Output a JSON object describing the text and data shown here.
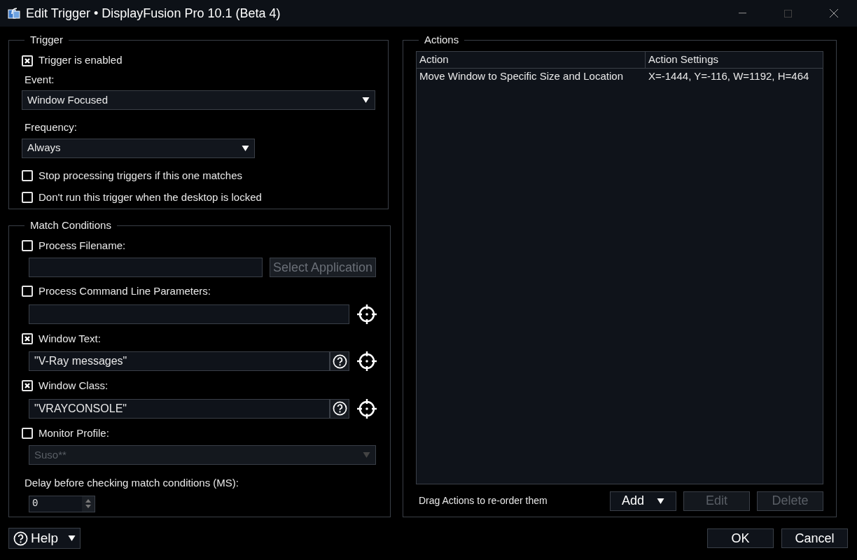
{
  "window": {
    "title": "Edit Trigger • DisplayFusion Pro 10.1 (Beta 4)"
  },
  "trigger": {
    "title": "Trigger",
    "enabled": {
      "label": "Trigger is enabled",
      "checked": true
    },
    "event": {
      "label": "Event:",
      "value": "Window Focused"
    },
    "frequency": {
      "label": "Frequency:",
      "value": "Always"
    },
    "options": [
      {
        "label": "Stop processing triggers if this one matches",
        "checked": false
      },
      {
        "label": "Don't run this trigger when the desktop is locked",
        "checked": false
      }
    ]
  },
  "match_conditions": {
    "title": "Match Conditions",
    "conditions": [
      {
        "kind": "app",
        "label": "Process Filename:",
        "checked": false,
        "button": {
          "label": "Select Application",
          "disabled": true
        }
      },
      {
        "kind": "pick",
        "label": "Process Command Line Parameters:",
        "checked": false
      },
      {
        "kind": "text",
        "label": "Window Text:",
        "checked": true,
        "value": "\"V-Ray messages\""
      },
      {
        "kind": "text",
        "label": "Window Class:",
        "checked": true,
        "value": "\"VRAYCONSOLE\""
      },
      {
        "kind": "dropdown",
        "label": "Monitor Profile:",
        "checked": false,
        "value": "Suso**",
        "disabled": true
      }
    ],
    "delay": {
      "label": "Delay before checking match conditions (MS):",
      "value": "0"
    }
  },
  "actions": {
    "title": "Actions",
    "columns": [
      "Action",
      "Action Settings"
    ],
    "rows": [
      [
        "Move Window to Specific Size and Location",
        "X=-1444, Y=-116, W=1192, H=464"
      ]
    ],
    "hint": "Drag Actions to re-order them",
    "buttons": [
      {
        "label": "Add",
        "disabled": false,
        "menu": true
      },
      {
        "label": "Edit",
        "disabled": true,
        "menu": false
      },
      {
        "label": "Delete",
        "disabled": true,
        "menu": false
      }
    ]
  },
  "footer": {
    "help": {
      "label": "Help"
    },
    "buttons": [
      {
        "label": "OK"
      },
      {
        "label": "Cancel"
      }
    ]
  }
}
